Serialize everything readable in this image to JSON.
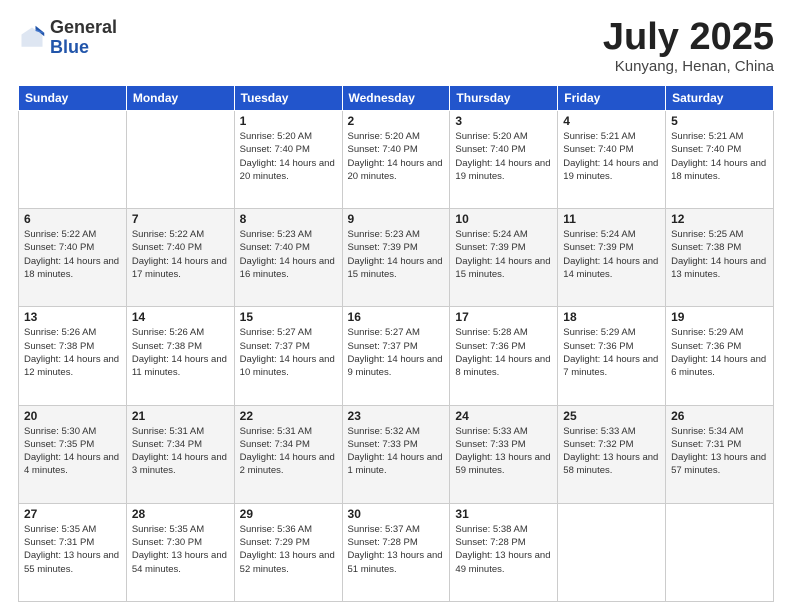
{
  "header": {
    "logo_general": "General",
    "logo_blue": "Blue",
    "month_title": "July 2025",
    "location": "Kunyang, Henan, China"
  },
  "weekdays": [
    "Sunday",
    "Monday",
    "Tuesday",
    "Wednesday",
    "Thursday",
    "Friday",
    "Saturday"
  ],
  "weeks": [
    [
      {
        "day": "",
        "sunrise": "",
        "sunset": "",
        "daylight": ""
      },
      {
        "day": "",
        "sunrise": "",
        "sunset": "",
        "daylight": ""
      },
      {
        "day": "1",
        "sunrise": "Sunrise: 5:20 AM",
        "sunset": "Sunset: 7:40 PM",
        "daylight": "Daylight: 14 hours and 20 minutes."
      },
      {
        "day": "2",
        "sunrise": "Sunrise: 5:20 AM",
        "sunset": "Sunset: 7:40 PM",
        "daylight": "Daylight: 14 hours and 20 minutes."
      },
      {
        "day": "3",
        "sunrise": "Sunrise: 5:20 AM",
        "sunset": "Sunset: 7:40 PM",
        "daylight": "Daylight: 14 hours and 19 minutes."
      },
      {
        "day": "4",
        "sunrise": "Sunrise: 5:21 AM",
        "sunset": "Sunset: 7:40 PM",
        "daylight": "Daylight: 14 hours and 19 minutes."
      },
      {
        "day": "5",
        "sunrise": "Sunrise: 5:21 AM",
        "sunset": "Sunset: 7:40 PM",
        "daylight": "Daylight: 14 hours and 18 minutes."
      }
    ],
    [
      {
        "day": "6",
        "sunrise": "Sunrise: 5:22 AM",
        "sunset": "Sunset: 7:40 PM",
        "daylight": "Daylight: 14 hours and 18 minutes."
      },
      {
        "day": "7",
        "sunrise": "Sunrise: 5:22 AM",
        "sunset": "Sunset: 7:40 PM",
        "daylight": "Daylight: 14 hours and 17 minutes."
      },
      {
        "day": "8",
        "sunrise": "Sunrise: 5:23 AM",
        "sunset": "Sunset: 7:40 PM",
        "daylight": "Daylight: 14 hours and 16 minutes."
      },
      {
        "day": "9",
        "sunrise": "Sunrise: 5:23 AM",
        "sunset": "Sunset: 7:39 PM",
        "daylight": "Daylight: 14 hours and 15 minutes."
      },
      {
        "day": "10",
        "sunrise": "Sunrise: 5:24 AM",
        "sunset": "Sunset: 7:39 PM",
        "daylight": "Daylight: 14 hours and 15 minutes."
      },
      {
        "day": "11",
        "sunrise": "Sunrise: 5:24 AM",
        "sunset": "Sunset: 7:39 PM",
        "daylight": "Daylight: 14 hours and 14 minutes."
      },
      {
        "day": "12",
        "sunrise": "Sunrise: 5:25 AM",
        "sunset": "Sunset: 7:38 PM",
        "daylight": "Daylight: 14 hours and 13 minutes."
      }
    ],
    [
      {
        "day": "13",
        "sunrise": "Sunrise: 5:26 AM",
        "sunset": "Sunset: 7:38 PM",
        "daylight": "Daylight: 14 hours and 12 minutes."
      },
      {
        "day": "14",
        "sunrise": "Sunrise: 5:26 AM",
        "sunset": "Sunset: 7:38 PM",
        "daylight": "Daylight: 14 hours and 11 minutes."
      },
      {
        "day": "15",
        "sunrise": "Sunrise: 5:27 AM",
        "sunset": "Sunset: 7:37 PM",
        "daylight": "Daylight: 14 hours and 10 minutes."
      },
      {
        "day": "16",
        "sunrise": "Sunrise: 5:27 AM",
        "sunset": "Sunset: 7:37 PM",
        "daylight": "Daylight: 14 hours and 9 minutes."
      },
      {
        "day": "17",
        "sunrise": "Sunrise: 5:28 AM",
        "sunset": "Sunset: 7:36 PM",
        "daylight": "Daylight: 14 hours and 8 minutes."
      },
      {
        "day": "18",
        "sunrise": "Sunrise: 5:29 AM",
        "sunset": "Sunset: 7:36 PM",
        "daylight": "Daylight: 14 hours and 7 minutes."
      },
      {
        "day": "19",
        "sunrise": "Sunrise: 5:29 AM",
        "sunset": "Sunset: 7:36 PM",
        "daylight": "Daylight: 14 hours and 6 minutes."
      }
    ],
    [
      {
        "day": "20",
        "sunrise": "Sunrise: 5:30 AM",
        "sunset": "Sunset: 7:35 PM",
        "daylight": "Daylight: 14 hours and 4 minutes."
      },
      {
        "day": "21",
        "sunrise": "Sunrise: 5:31 AM",
        "sunset": "Sunset: 7:34 PM",
        "daylight": "Daylight: 14 hours and 3 minutes."
      },
      {
        "day": "22",
        "sunrise": "Sunrise: 5:31 AM",
        "sunset": "Sunset: 7:34 PM",
        "daylight": "Daylight: 14 hours and 2 minutes."
      },
      {
        "day": "23",
        "sunrise": "Sunrise: 5:32 AM",
        "sunset": "Sunset: 7:33 PM",
        "daylight": "Daylight: 14 hours and 1 minute."
      },
      {
        "day": "24",
        "sunrise": "Sunrise: 5:33 AM",
        "sunset": "Sunset: 7:33 PM",
        "daylight": "Daylight: 13 hours and 59 minutes."
      },
      {
        "day": "25",
        "sunrise": "Sunrise: 5:33 AM",
        "sunset": "Sunset: 7:32 PM",
        "daylight": "Daylight: 13 hours and 58 minutes."
      },
      {
        "day": "26",
        "sunrise": "Sunrise: 5:34 AM",
        "sunset": "Sunset: 7:31 PM",
        "daylight": "Daylight: 13 hours and 57 minutes."
      }
    ],
    [
      {
        "day": "27",
        "sunrise": "Sunrise: 5:35 AM",
        "sunset": "Sunset: 7:31 PM",
        "daylight": "Daylight: 13 hours and 55 minutes."
      },
      {
        "day": "28",
        "sunrise": "Sunrise: 5:35 AM",
        "sunset": "Sunset: 7:30 PM",
        "daylight": "Daylight: 13 hours and 54 minutes."
      },
      {
        "day": "29",
        "sunrise": "Sunrise: 5:36 AM",
        "sunset": "Sunset: 7:29 PM",
        "daylight": "Daylight: 13 hours and 52 minutes."
      },
      {
        "day": "30",
        "sunrise": "Sunrise: 5:37 AM",
        "sunset": "Sunset: 7:28 PM",
        "daylight": "Daylight: 13 hours and 51 minutes."
      },
      {
        "day": "31",
        "sunrise": "Sunrise: 5:38 AM",
        "sunset": "Sunset: 7:28 PM",
        "daylight": "Daylight: 13 hours and 49 minutes."
      },
      {
        "day": "",
        "sunrise": "",
        "sunset": "",
        "daylight": ""
      },
      {
        "day": "",
        "sunrise": "",
        "sunset": "",
        "daylight": ""
      }
    ]
  ]
}
